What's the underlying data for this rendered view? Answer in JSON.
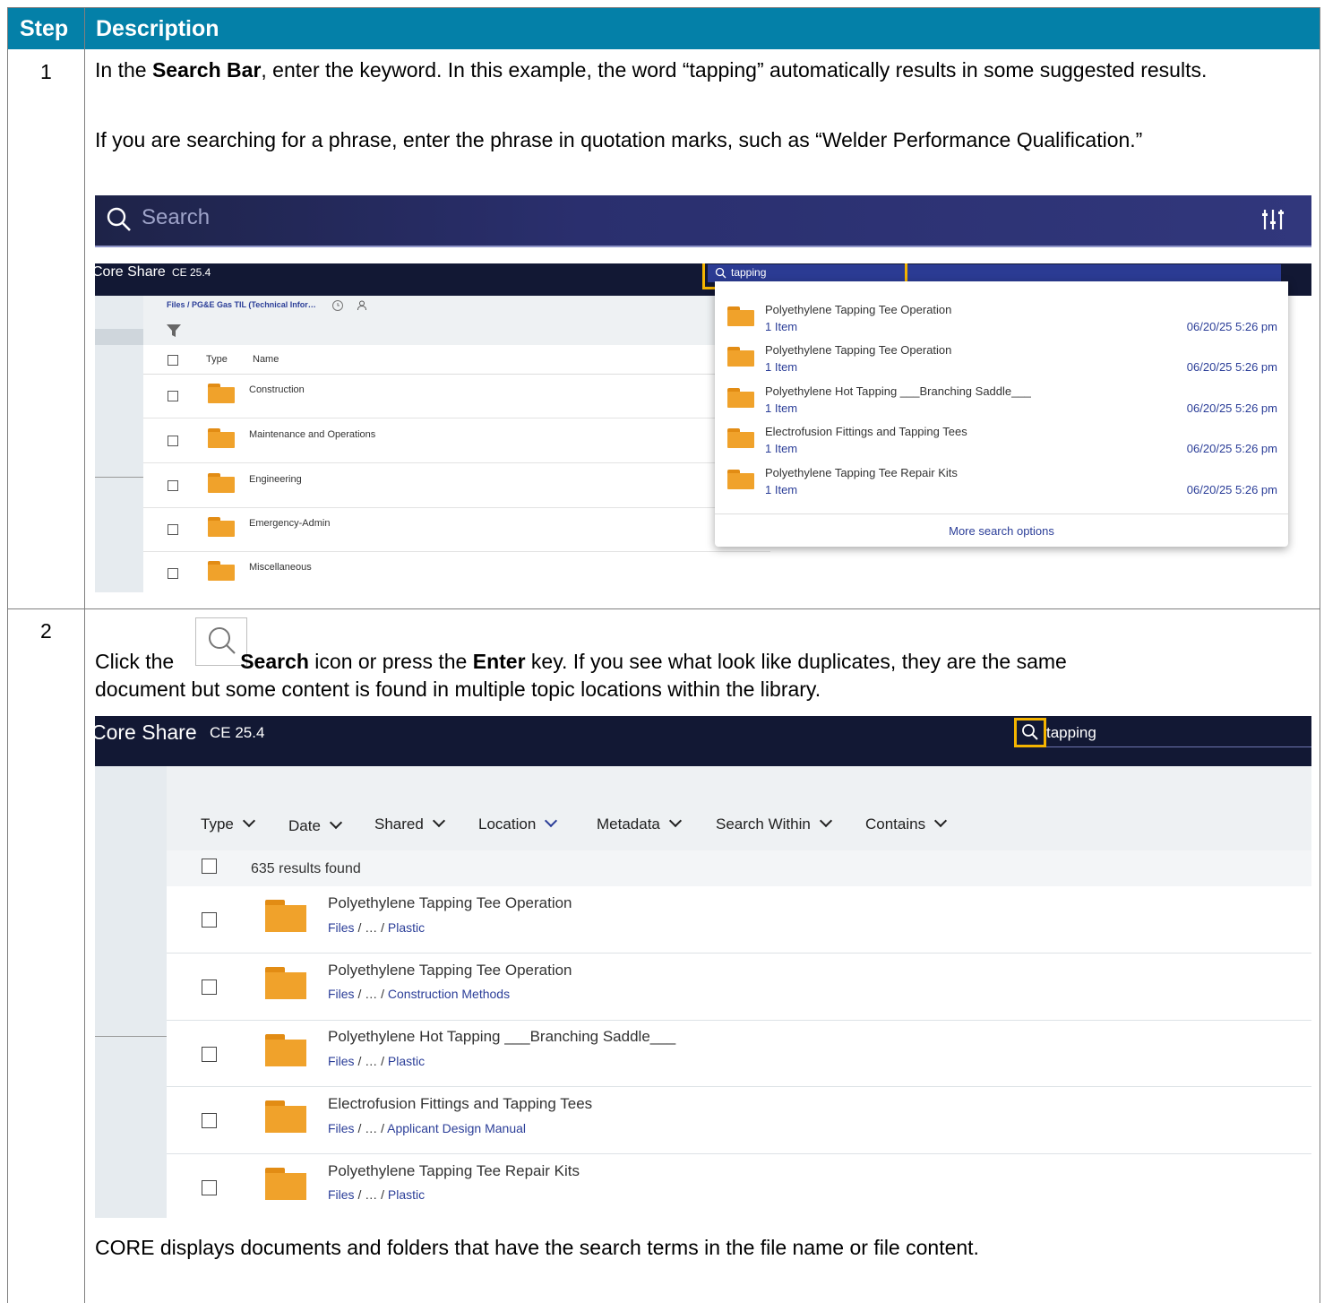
{
  "table": {
    "col_step": "Step",
    "col_description": "Description"
  },
  "step1": {
    "number": "1",
    "p1_a": "In the ",
    "p1_b": "Search Bar",
    "p1_c": ", enter the keyword. In this example, the word “tapping” automatically results in some suggested results.",
    "p2": "If you are searching for a phrase, enter the phrase in quotation marks, such as “Welder Performance Qualification.”",
    "searchbar": {
      "placeholder": "Search"
    },
    "app": {
      "title": "Core Share",
      "version": "CE 25.4",
      "search_value": "tapping",
      "breadcrumb": "Files / PG&E Gas TIL (Technical Infor…",
      "col_type": "Type",
      "col_name": "Name",
      "folders": [
        "Construction",
        "Maintenance and Operations",
        "Engineering",
        "Emergency-Admin",
        "Miscellaneous"
      ],
      "suggestions": [
        {
          "title": "Polyethylene Tapping Tee Operation",
          "count": "1 Item",
          "date": "06/20/25 5:26 pm"
        },
        {
          "title": "Polyethylene Tapping Tee Operation",
          "count": "1 Item",
          "date": "06/20/25 5:26 pm"
        },
        {
          "title": "Polyethylene Hot Tapping ___Branching Saddle___",
          "count": "1 Item",
          "date": "06/20/25 5:26 pm"
        },
        {
          "title": "Electrofusion Fittings and Tapping Tees",
          "count": "1 Item",
          "date": "06/20/25 5:26 pm"
        },
        {
          "title": "Polyethylene Tapping Tee Repair Kits",
          "count": "1 Item",
          "date": "06/20/25 5:26 pm"
        }
      ],
      "more_options": "More search options"
    }
  },
  "step2": {
    "number": "2",
    "p1_a": "Click the",
    "p1_b": "Search",
    "p1_c": " icon or press the ",
    "p1_d": "Enter",
    "p1_e": " key. If you see what look like duplicates, they are the same",
    "p1_f": "document but some content is found in multiple topic locations within the library.",
    "app": {
      "title": "Core Share",
      "version": "CE 25.4",
      "search_value": "tapping",
      "filters": [
        "Type",
        "Date",
        "Shared",
        "Location",
        "Metadata",
        "Search Within",
        "Contains"
      ],
      "results_count": "635 results found",
      "results": [
        {
          "title": "Polyethylene Tapping Tee Operation",
          "path_a": "Files",
          "path_b": " / … / ",
          "path_c": "Plastic"
        },
        {
          "title": "Polyethylene Tapping Tee Operation",
          "path_a": "Files",
          "path_b": " / … / ",
          "path_c": "Construction Methods"
        },
        {
          "title": "Polyethylene Hot Tapping ___Branching Saddle___",
          "path_a": "Files",
          "path_b": " / … / ",
          "path_c": "Plastic"
        },
        {
          "title": "Electrofusion Fittings and Tapping Tees",
          "path_a": "Files",
          "path_b": " / … / ",
          "path_c": "Applicant Design Manual"
        },
        {
          "title": "Polyethylene Tapping Tee Repair Kits",
          "path_a": "Files",
          "path_b": " / … / ",
          "path_c": "Plastic"
        }
      ]
    },
    "footer": "CORE displays documents and folders that have the search terms in the file name or file content."
  },
  "colors": {
    "header": "#0480a8",
    "folder": "#f0a22b",
    "highlight": "#f4b400",
    "link": "#2b3e98",
    "appbar": "#121834"
  }
}
